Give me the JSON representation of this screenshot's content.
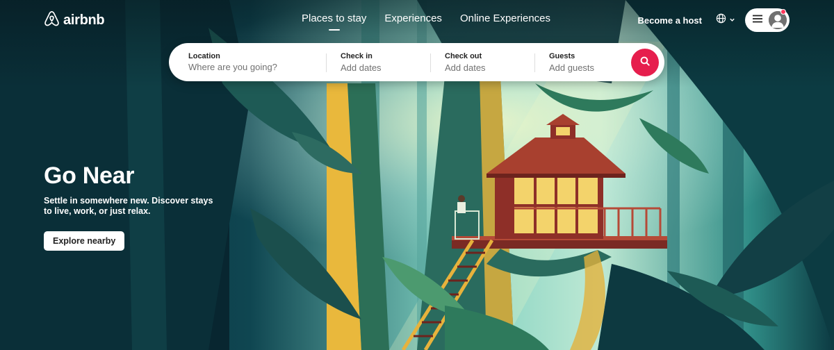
{
  "brand": {
    "name": "airbnb",
    "accent_color": "#ff385c",
    "search_button_color": "#e61e4d",
    "logo_icon": "airbnb-belo-icon"
  },
  "nav": {
    "tabs": [
      {
        "label": "Places to stay",
        "active": true
      },
      {
        "label": "Experiences",
        "active": false
      },
      {
        "label": "Online Experiences",
        "active": false
      }
    ]
  },
  "header_right": {
    "host_label": "Become a host",
    "language_icon": "globe-icon",
    "menu_icon": "hamburger-menu-icon",
    "avatar_icon": "user-avatar-icon",
    "has_notification": true
  },
  "search": {
    "fields": [
      {
        "label": "Location",
        "placeholder": "Where are you going?"
      },
      {
        "label": "Check in",
        "value": "Add dates"
      },
      {
        "label": "Check out",
        "value": "Add dates"
      },
      {
        "label": "Guests",
        "value": "Add guests"
      }
    ],
    "button_icon": "search-icon"
  },
  "hero": {
    "title": "Go Near",
    "subtitle": "Settle in somewhere new. Discover stays to live, work, or just relax.",
    "cta_label": "Explore nearby",
    "illustration": "treehouse-in-forest"
  }
}
